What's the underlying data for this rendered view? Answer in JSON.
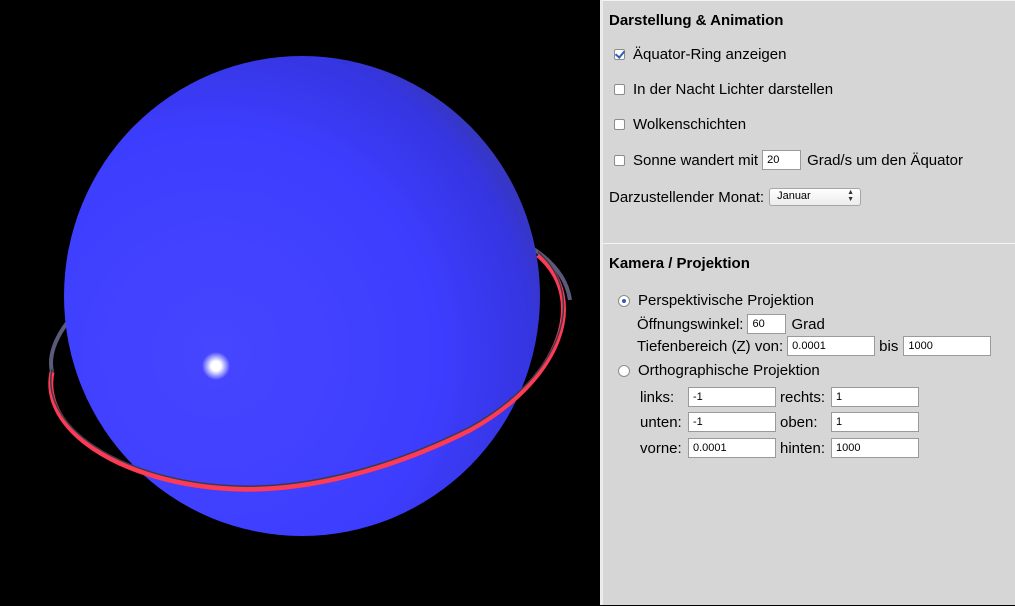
{
  "animation": {
    "title": "Darstellung & Animation",
    "equator_ring": {
      "label": "Äquator-Ring anzeigen",
      "checked": true
    },
    "night_lights": {
      "label": "In der Nacht Lichter darstellen",
      "checked": false
    },
    "clouds": {
      "label": "Wolkenschichten",
      "checked": false
    },
    "sun": {
      "label_before": "Sonne wandert mit",
      "value": "20",
      "label_after": "Grad/s um den Äquator",
      "checked": false
    },
    "month": {
      "label": "Darzustellender Monat:",
      "selected": "Januar"
    }
  },
  "camera": {
    "title": "Kamera / Projektion",
    "perspective": {
      "label": "Perspektivische Projektion",
      "selected": true,
      "fov_label": "Öffnungswinkel:",
      "fov_value": "60",
      "fov_unit": "Grad",
      "depth_label": "Tiefenbereich (Z) von:",
      "depth_from": "0.0001",
      "depth_to_label": "bis",
      "depth_to": "1000"
    },
    "ortho": {
      "label": "Orthographische Projektion",
      "selected": false,
      "left_label": "links:",
      "left_value": "-1",
      "right_label": "rechts:",
      "right_value": "1",
      "bottom_label": "unten:",
      "bottom_value": "-1",
      "top_label": "oben:",
      "top_value": "1",
      "near_label": "vorne:",
      "near_value": "0.0001",
      "far_label": "hinten:",
      "far_value": "1000"
    }
  },
  "colors": {
    "sphere": "#3b3bff",
    "ring": "#e0314a",
    "panel": "#d6d6d6",
    "accent": "#2a5fb5"
  }
}
